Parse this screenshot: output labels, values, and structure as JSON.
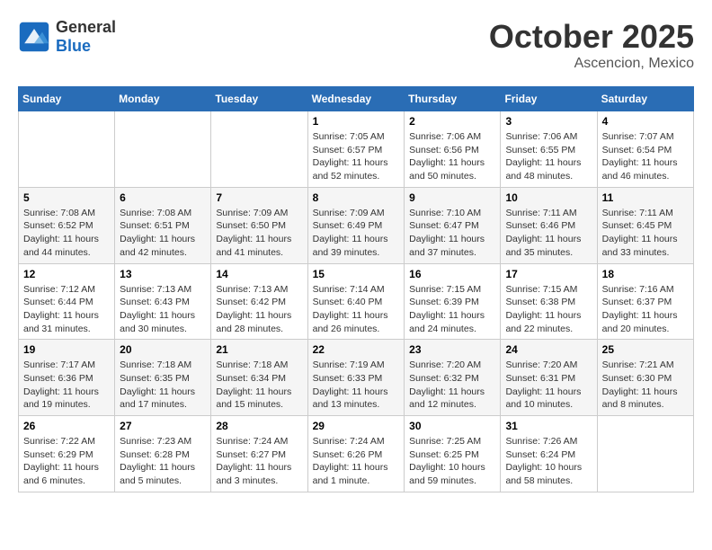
{
  "header": {
    "logo_general": "General",
    "logo_blue": "Blue",
    "month_title": "October 2025",
    "location": "Ascencion, Mexico"
  },
  "days_of_week": [
    "Sunday",
    "Monday",
    "Tuesday",
    "Wednesday",
    "Thursday",
    "Friday",
    "Saturday"
  ],
  "weeks": [
    [
      {
        "day": "",
        "sunrise": "",
        "sunset": "",
        "daylight": ""
      },
      {
        "day": "",
        "sunrise": "",
        "sunset": "",
        "daylight": ""
      },
      {
        "day": "",
        "sunrise": "",
        "sunset": "",
        "daylight": ""
      },
      {
        "day": "1",
        "sunrise": "Sunrise: 7:05 AM",
        "sunset": "Sunset: 6:57 PM",
        "daylight": "Daylight: 11 hours and 52 minutes."
      },
      {
        "day": "2",
        "sunrise": "Sunrise: 7:06 AM",
        "sunset": "Sunset: 6:56 PM",
        "daylight": "Daylight: 11 hours and 50 minutes."
      },
      {
        "day": "3",
        "sunrise": "Sunrise: 7:06 AM",
        "sunset": "Sunset: 6:55 PM",
        "daylight": "Daylight: 11 hours and 48 minutes."
      },
      {
        "day": "4",
        "sunrise": "Sunrise: 7:07 AM",
        "sunset": "Sunset: 6:54 PM",
        "daylight": "Daylight: 11 hours and 46 minutes."
      }
    ],
    [
      {
        "day": "5",
        "sunrise": "Sunrise: 7:08 AM",
        "sunset": "Sunset: 6:52 PM",
        "daylight": "Daylight: 11 hours and 44 minutes."
      },
      {
        "day": "6",
        "sunrise": "Sunrise: 7:08 AM",
        "sunset": "Sunset: 6:51 PM",
        "daylight": "Daylight: 11 hours and 42 minutes."
      },
      {
        "day": "7",
        "sunrise": "Sunrise: 7:09 AM",
        "sunset": "Sunset: 6:50 PM",
        "daylight": "Daylight: 11 hours and 41 minutes."
      },
      {
        "day": "8",
        "sunrise": "Sunrise: 7:09 AM",
        "sunset": "Sunset: 6:49 PM",
        "daylight": "Daylight: 11 hours and 39 minutes."
      },
      {
        "day": "9",
        "sunrise": "Sunrise: 7:10 AM",
        "sunset": "Sunset: 6:47 PM",
        "daylight": "Daylight: 11 hours and 37 minutes."
      },
      {
        "day": "10",
        "sunrise": "Sunrise: 7:11 AM",
        "sunset": "Sunset: 6:46 PM",
        "daylight": "Daylight: 11 hours and 35 minutes."
      },
      {
        "day": "11",
        "sunrise": "Sunrise: 7:11 AM",
        "sunset": "Sunset: 6:45 PM",
        "daylight": "Daylight: 11 hours and 33 minutes."
      }
    ],
    [
      {
        "day": "12",
        "sunrise": "Sunrise: 7:12 AM",
        "sunset": "Sunset: 6:44 PM",
        "daylight": "Daylight: 11 hours and 31 minutes."
      },
      {
        "day": "13",
        "sunrise": "Sunrise: 7:13 AM",
        "sunset": "Sunset: 6:43 PM",
        "daylight": "Daylight: 11 hours and 30 minutes."
      },
      {
        "day": "14",
        "sunrise": "Sunrise: 7:13 AM",
        "sunset": "Sunset: 6:42 PM",
        "daylight": "Daylight: 11 hours and 28 minutes."
      },
      {
        "day": "15",
        "sunrise": "Sunrise: 7:14 AM",
        "sunset": "Sunset: 6:40 PM",
        "daylight": "Daylight: 11 hours and 26 minutes."
      },
      {
        "day": "16",
        "sunrise": "Sunrise: 7:15 AM",
        "sunset": "Sunset: 6:39 PM",
        "daylight": "Daylight: 11 hours and 24 minutes."
      },
      {
        "day": "17",
        "sunrise": "Sunrise: 7:15 AM",
        "sunset": "Sunset: 6:38 PM",
        "daylight": "Daylight: 11 hours and 22 minutes."
      },
      {
        "day": "18",
        "sunrise": "Sunrise: 7:16 AM",
        "sunset": "Sunset: 6:37 PM",
        "daylight": "Daylight: 11 hours and 20 minutes."
      }
    ],
    [
      {
        "day": "19",
        "sunrise": "Sunrise: 7:17 AM",
        "sunset": "Sunset: 6:36 PM",
        "daylight": "Daylight: 11 hours and 19 minutes."
      },
      {
        "day": "20",
        "sunrise": "Sunrise: 7:18 AM",
        "sunset": "Sunset: 6:35 PM",
        "daylight": "Daylight: 11 hours and 17 minutes."
      },
      {
        "day": "21",
        "sunrise": "Sunrise: 7:18 AM",
        "sunset": "Sunset: 6:34 PM",
        "daylight": "Daylight: 11 hours and 15 minutes."
      },
      {
        "day": "22",
        "sunrise": "Sunrise: 7:19 AM",
        "sunset": "Sunset: 6:33 PM",
        "daylight": "Daylight: 11 hours and 13 minutes."
      },
      {
        "day": "23",
        "sunrise": "Sunrise: 7:20 AM",
        "sunset": "Sunset: 6:32 PM",
        "daylight": "Daylight: 11 hours and 12 minutes."
      },
      {
        "day": "24",
        "sunrise": "Sunrise: 7:20 AM",
        "sunset": "Sunset: 6:31 PM",
        "daylight": "Daylight: 11 hours and 10 minutes."
      },
      {
        "day": "25",
        "sunrise": "Sunrise: 7:21 AM",
        "sunset": "Sunset: 6:30 PM",
        "daylight": "Daylight: 11 hours and 8 minutes."
      }
    ],
    [
      {
        "day": "26",
        "sunrise": "Sunrise: 7:22 AM",
        "sunset": "Sunset: 6:29 PM",
        "daylight": "Daylight: 11 hours and 6 minutes."
      },
      {
        "day": "27",
        "sunrise": "Sunrise: 7:23 AM",
        "sunset": "Sunset: 6:28 PM",
        "daylight": "Daylight: 11 hours and 5 minutes."
      },
      {
        "day": "28",
        "sunrise": "Sunrise: 7:24 AM",
        "sunset": "Sunset: 6:27 PM",
        "daylight": "Daylight: 11 hours and 3 minutes."
      },
      {
        "day": "29",
        "sunrise": "Sunrise: 7:24 AM",
        "sunset": "Sunset: 6:26 PM",
        "daylight": "Daylight: 11 hours and 1 minute."
      },
      {
        "day": "30",
        "sunrise": "Sunrise: 7:25 AM",
        "sunset": "Sunset: 6:25 PM",
        "daylight": "Daylight: 10 hours and 59 minutes."
      },
      {
        "day": "31",
        "sunrise": "Sunrise: 7:26 AM",
        "sunset": "Sunset: 6:24 PM",
        "daylight": "Daylight: 10 hours and 58 minutes."
      },
      {
        "day": "",
        "sunrise": "",
        "sunset": "",
        "daylight": ""
      }
    ]
  ]
}
